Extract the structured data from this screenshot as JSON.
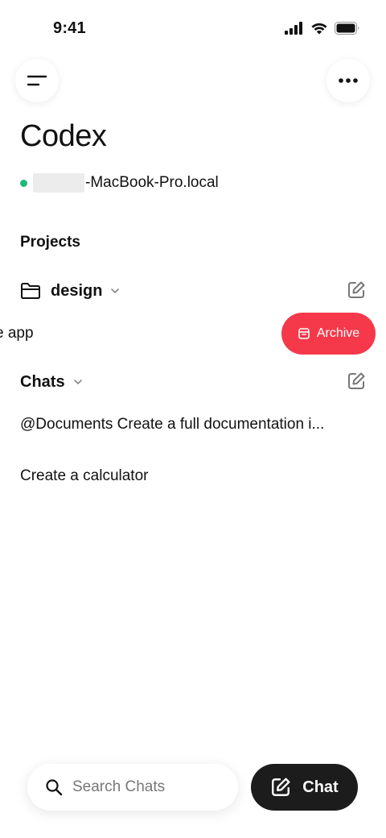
{
  "status_bar": {
    "time": "9:41"
  },
  "header": {
    "title": "Codex"
  },
  "host": {
    "name_suffix": "-MacBook-Pro.local",
    "status_color": "#1db87a"
  },
  "projects": {
    "section_label": "Projects",
    "items": [
      {
        "name": "design",
        "icon": "folder-icon"
      }
    ]
  },
  "swipe_row": {
    "visible_text": "e app",
    "action_label": "Archive",
    "action_color": "#f5394a"
  },
  "chats": {
    "section_label": "Chats",
    "items": [
      {
        "label": "@Documents Create a full documentation i..."
      },
      {
        "label": "Create a calculator"
      }
    ]
  },
  "bottom_bar": {
    "search_placeholder": "Search Chats",
    "chat_button_label": "Chat"
  }
}
